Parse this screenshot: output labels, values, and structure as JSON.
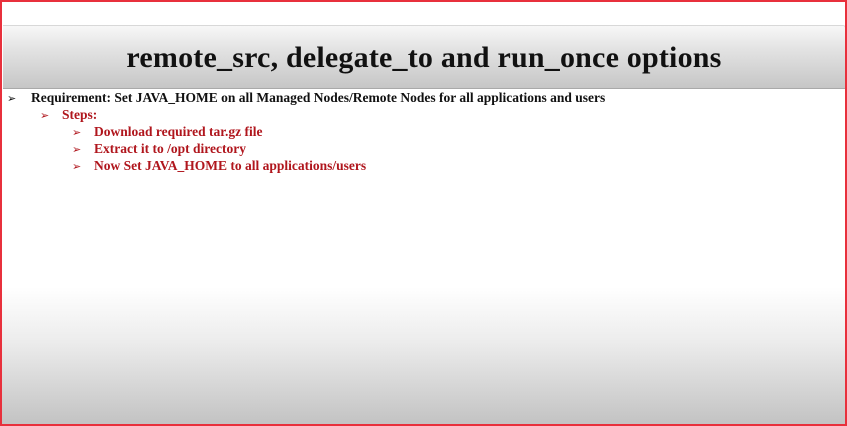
{
  "slide": {
    "title": "remote_src, delegate_to and run_once options",
    "bullet_glyph": "➢",
    "requirement": "Requirement: Set JAVA_HOME on all Managed Nodes/Remote Nodes for all applications and users",
    "steps_label": "Steps:",
    "steps": [
      "Download required tar.gz file",
      "Extract it to /opt directory",
      "Now Set JAVA_HOME to all applications/users"
    ],
    "colors": {
      "border": "#e8303c",
      "accent_text": "#b0161d",
      "body_text": "#111111"
    }
  }
}
